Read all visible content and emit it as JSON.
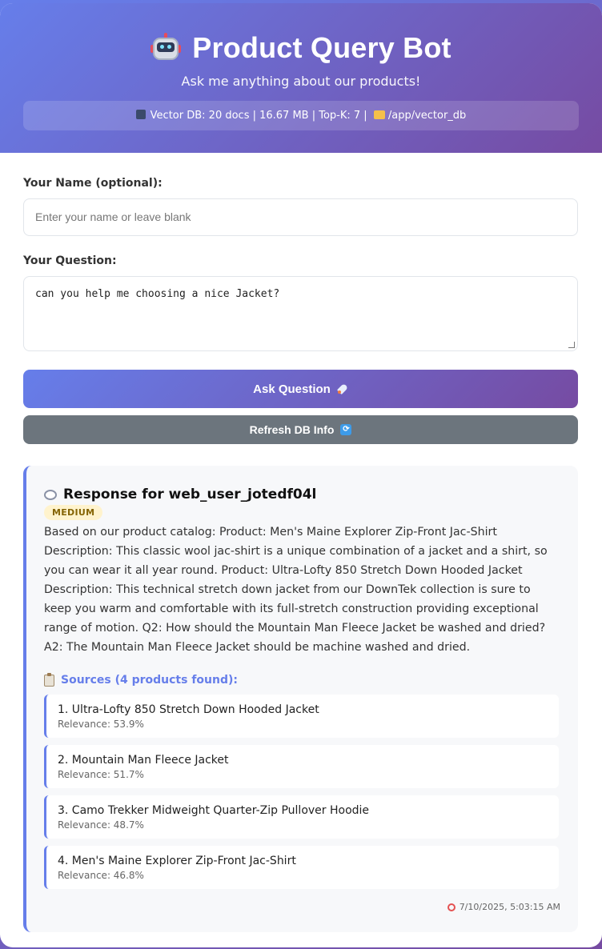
{
  "header": {
    "title": "Product Query Bot",
    "subtitle": "Ask me anything about our products!",
    "db_info_prefix": "Vector DB: 20 docs | 16.67 MB | Top-K: 7 |",
    "db_path": "/app/vector_db",
    "icons": [
      "robot-icon",
      "floppy-disk-icon",
      "folder-icon"
    ]
  },
  "form": {
    "name_label": "Your Name (optional):",
    "name_placeholder": "Enter your name or leave blank",
    "question_label": "Your Question:",
    "question_value": "can you help me choosing a nice Jacket?",
    "ask_label": "Ask Question",
    "refresh_label": "Refresh DB Info"
  },
  "response": {
    "title": "Response for web_user_jotedf04l",
    "badge": "MEDIUM",
    "answer": "Based on our product catalog: Product: Men's Maine Explorer Zip-Front Jac-Shirt Description: This classic wool jac-shirt is a unique combination of a jacket and a shirt, so you can wear it all year round. Product: Ultra-Lofty 850 Stretch Down Hooded Jacket Description: This technical stretch down jacket from our DownTek collection is sure to keep you warm and comfortable with its full-stretch construction providing exceptional range of motion. Q2: How should the Mountain Man Fleece Jacket be washed and dried? A2: The Mountain Man Fleece Jacket should be machine washed and dried.",
    "sources_title": "Sources (4 products found):",
    "sources": [
      {
        "title": "1. Ultra-Lofty 850 Stretch Down Hooded Jacket",
        "relevance": "Relevance: 53.9%"
      },
      {
        "title": "2. Mountain Man Fleece Jacket",
        "relevance": "Relevance: 51.7%"
      },
      {
        "title": "3. Camo Trekker Midweight Quarter-Zip Pullover Hoodie",
        "relevance": "Relevance: 48.7%"
      },
      {
        "title": "4. Men's Maine Explorer Zip-Front Jac-Shirt",
        "relevance": "Relevance: 46.8%"
      }
    ],
    "timestamp": "7/10/2025, 5:03:15 AM"
  },
  "colors": {
    "accent": "#667eea",
    "accent_end": "#764ba2",
    "refresh_button": "#6c757d",
    "badge_bg": "#fff3cd"
  }
}
